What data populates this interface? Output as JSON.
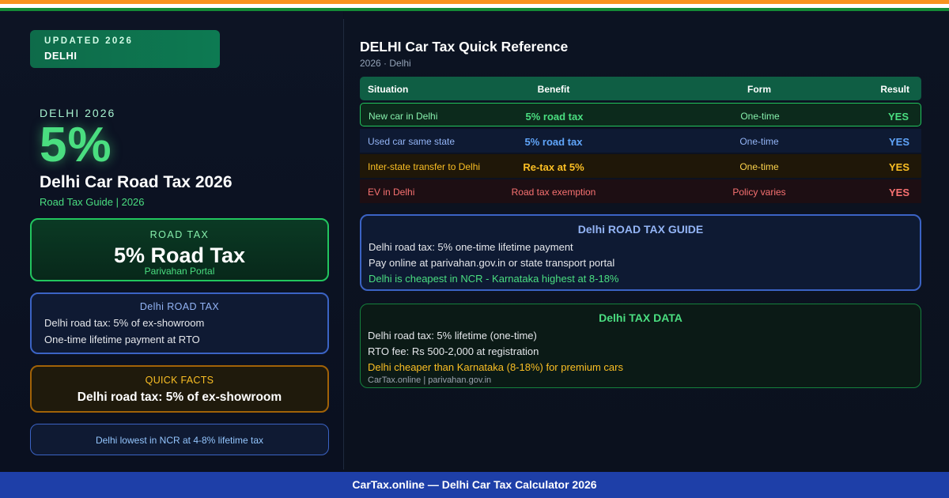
{
  "colors": {
    "accent_green": "#4ade80",
    "accent_blue": "#93b4f5",
    "accent_amber": "#fbbf24",
    "accent_red": "#f87171",
    "flag_saffron": "#f7931e",
    "flag_white": "#ffffff",
    "flag_green": "#138a36",
    "footer_blue": "#1e3fa8"
  },
  "left": {
    "badge": {
      "line1": "UPDATED 2026",
      "line2": "DELHI"
    },
    "eyebrow": "DELHI 2026",
    "big_value": "5%",
    "title": "Delhi Car Road Tax 2026",
    "subtitle": "Road Tax Guide | 2026",
    "road_tax_card": {
      "title": "ROAD TAX",
      "value": "5% Road Tax",
      "sub": "Parivahan Portal"
    },
    "info_card": {
      "title": "Delhi ROAD TAX",
      "lines": [
        "Delhi road tax: 5% of ex-showroom",
        "One-time lifetime payment at RTO"
      ]
    },
    "quick_facts": {
      "title": "QUICK FACTS",
      "value": "Delhi road tax: 5% of ex-showroom"
    },
    "note": "Delhi lowest in NCR at 4-8% lifetime tax"
  },
  "right": {
    "title": "DELHI Car Tax Quick Reference",
    "subtitle": "2026 · Delhi",
    "table": {
      "headers": [
        "Situation",
        "Benefit",
        "Form",
        "Result"
      ],
      "rows": [
        {
          "situation": "New car in Delhi",
          "benefit": "5% road tax",
          "form": "One-time",
          "result": "YES"
        },
        {
          "situation": "Used car same state",
          "benefit": "5% road tax",
          "form": "One-time",
          "result": "YES"
        },
        {
          "situation": "Inter-state transfer to Delhi",
          "benefit": "Re-tax at 5%",
          "form": "One-time",
          "result": "YES"
        },
        {
          "situation": "EV in Delhi",
          "benefit": "Road tax exemption",
          "form": "Policy varies",
          "result": "YES"
        }
      ]
    },
    "guide": {
      "title": "Delhi ROAD TAX GUIDE",
      "lines": [
        "Delhi road tax: 5% one-time lifetime payment",
        "Pay online at parivahan.gov.in or state transport portal",
        "Delhi is cheapest in NCR - Karnataka highest at 8-18%"
      ]
    },
    "data": {
      "title": "Delhi TAX DATA",
      "lines": [
        "Delhi road tax: 5% lifetime (one-time)",
        "RTO fee: Rs 500-2,000 at registration",
        "Delhi cheaper than Karnataka (8-18%) for premium cars"
      ],
      "source": "CarTax.online | parivahan.gov.in"
    }
  },
  "footer": "CarTax.online — Delhi Car Tax Calculator 2026"
}
